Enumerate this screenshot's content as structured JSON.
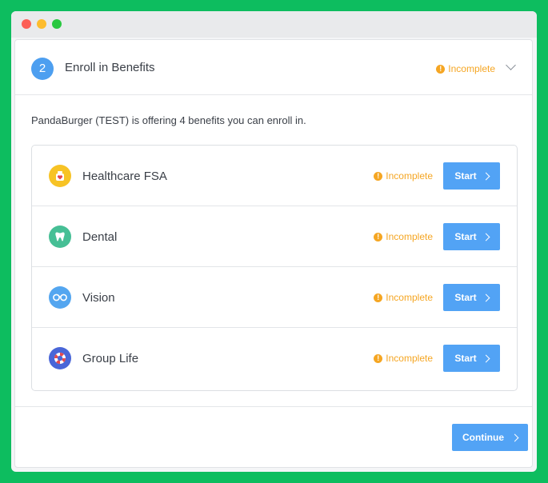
{
  "window": {
    "controls": [
      "close",
      "minimize",
      "zoom"
    ]
  },
  "header": {
    "step_number": "2",
    "title": "Enroll in Benefits",
    "status": "Incomplete",
    "warning_glyph": "!"
  },
  "intro": "PandaBurger (TEST) is offering 4 benefits you can enroll in.",
  "benefits": [
    {
      "label": "Healthcare FSA",
      "status": "Incomplete",
      "button": "Start",
      "icon": "healthcare-fsa-icon",
      "icon_color": "#f7c325"
    },
    {
      "label": "Dental",
      "status": "Incomplete",
      "button": "Start",
      "icon": "tooth-icon",
      "icon_color": "#46bf95"
    },
    {
      "label": "Vision",
      "status": "Incomplete",
      "button": "Start",
      "icon": "glasses-icon",
      "icon_color": "#54a6f0"
    },
    {
      "label": "Group Life",
      "status": "Incomplete",
      "button": "Start",
      "icon": "lifebuoy-icon",
      "icon_color": "#4966d8"
    }
  ],
  "footer": {
    "continue_label": "Continue"
  },
  "colors": {
    "accent": "#52a3f5",
    "warning": "#f5a623",
    "background": "#0dbd5f"
  }
}
